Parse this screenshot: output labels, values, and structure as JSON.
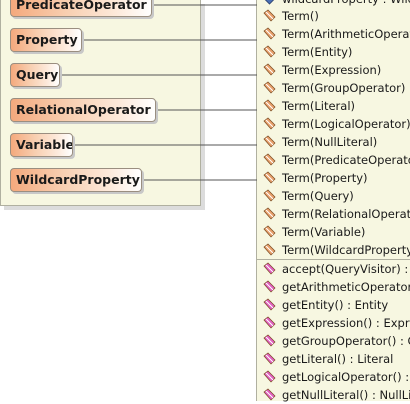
{
  "colors": {
    "panel_bg": "#f7f7e1",
    "node_gradient_start": "#f4a97d",
    "connector": "#555555",
    "constructor_icon": "#e8a06c",
    "method_icon": "#e060c0"
  },
  "classes": [
    {
      "name": "PredicateOperator"
    },
    {
      "name": "Property"
    },
    {
      "name": "Query"
    },
    {
      "name": "RelationalOperator"
    },
    {
      "name": "Variable"
    },
    {
      "name": "WildcardProperty"
    }
  ],
  "member_panel": {
    "cut_row": "wildcardProperty : Wildca",
    "constructors": [
      {
        "text": "Term()",
        "icon": "constructor-icon"
      },
      {
        "text": "Term(ArithmeticOperator",
        "icon": "constructor-icon"
      },
      {
        "text": "Term(Entity)",
        "icon": "constructor-icon"
      },
      {
        "text": "Term(Expression)",
        "icon": "constructor-icon"
      },
      {
        "text": "Term(GroupOperator)",
        "icon": "constructor-icon"
      },
      {
        "text": "Term(Literal)",
        "icon": "constructor-icon"
      },
      {
        "text": "Term(LogicalOperator)",
        "icon": "constructor-icon"
      },
      {
        "text": "Term(NullLiteral)",
        "icon": "constructor-icon"
      },
      {
        "text": "Term(PredicateOperato",
        "icon": "constructor-icon"
      },
      {
        "text": "Term(Property)",
        "icon": "constructor-icon"
      },
      {
        "text": "Term(Query)",
        "icon": "constructor-icon"
      },
      {
        "text": "Term(RelationalOperato",
        "icon": "constructor-icon"
      },
      {
        "text": "Term(Variable)",
        "icon": "constructor-icon"
      },
      {
        "text": "Term(WildcardProperty)",
        "icon": "constructor-icon"
      }
    ],
    "methods": [
      {
        "text": "accept(QueryVisitor) : vo",
        "icon": "method-icon"
      },
      {
        "text": "getArithmeticOperator()",
        "icon": "method-icon"
      },
      {
        "text": "getEntity() : Entity",
        "icon": "method-icon"
      },
      {
        "text": "getExpression() : Expres",
        "icon": "method-icon"
      },
      {
        "text": "getGroupOperator() : Gr",
        "icon": "method-icon"
      },
      {
        "text": "getLiteral() : Literal",
        "icon": "method-icon"
      },
      {
        "text": "getLogicalOperator() : L",
        "icon": "method-icon"
      },
      {
        "text": "getNullLiteral() : NullLite",
        "icon": "method-icon"
      }
    ]
  }
}
